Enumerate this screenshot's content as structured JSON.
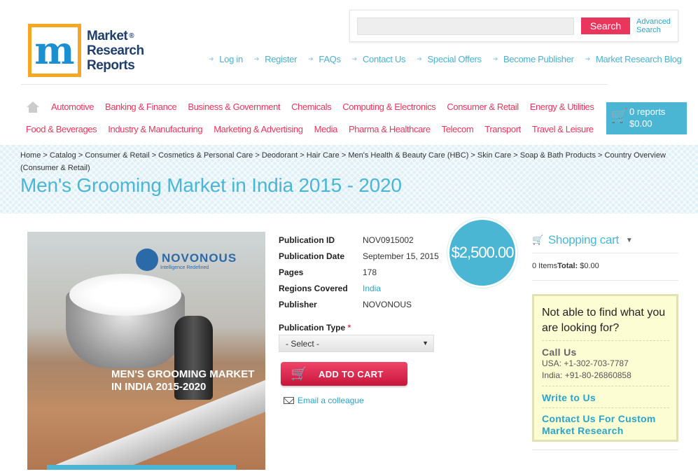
{
  "logo": {
    "line1": "Market",
    "line2": "Research",
    "line3": "Reports",
    "reg": "®"
  },
  "search": {
    "button_label": "Search",
    "advanced_line1": "Advanced",
    "advanced_line2": "Search"
  },
  "toplinks": [
    "Log in",
    "Register",
    "FAQs",
    "Contact Us",
    "Special Offers",
    "Become Publisher",
    "Market Research Blog"
  ],
  "categories_row1": [
    "Automotive",
    "Banking & Finance",
    "Business & Government",
    "Chemicals",
    "Computing & Electronics",
    "Consumer & Retail",
    "Energy & Utilities"
  ],
  "categories_row2": [
    "Food & Beverages",
    "Industry & Manufacturing",
    "Marketing & Advertising",
    "Media",
    "Pharma & Healthcare",
    "Telecom",
    "Transport",
    "Travel & Leisure"
  ],
  "cart": {
    "reports": "0 reports",
    "amount": "$0.00"
  },
  "breadcrumb": "Home > Catalog > Consumer & Retail > Cosmetics & Personal Care > Deodorant > Hair Care > Men's Health & Beauty Care (HBC) > Skin Care > Soap & Bath Products > Country Overview (Consumer & Retail)",
  "title": "Men's Grooming Market in India 2015 - 2020",
  "cover": {
    "brand": "NOVONOUS",
    "brand_sub": "Intelligence Redefined",
    "title_line1": "MEN'S GROOMING MARKET",
    "title_line2": "IN INDIA 2015-2020"
  },
  "details": [
    {
      "label": "Publication ID",
      "value": "NOV0915002"
    },
    {
      "label": "Publication Date",
      "value": "September 15, 2015"
    },
    {
      "label": "Pages",
      "value": "178"
    },
    {
      "label": "Regions Covered",
      "value": "India"
    },
    {
      "label": "Publisher",
      "value": "NOVONOUS"
    }
  ],
  "price": "$2,500.00",
  "publication_type": {
    "label": "Publication Type",
    "required": "*",
    "selected": "- Select -"
  },
  "add_to_cart": "ADD TO CART",
  "email_colleague": "Email a colleague",
  "shopping_cart": {
    "title": "Shopping cart",
    "items": "0 Items",
    "total_label": "Total:",
    "total_value": "$0.00"
  },
  "help": {
    "question": "Not able to find what you are looking for?",
    "call_us": "Call Us",
    "usa": "USA: +1-302-703-7787",
    "india": "India: +91-80-26860858",
    "write_to_us": "Write to Us",
    "custom_research": "Contact Us For Custom Market Research"
  },
  "colors": {
    "accent": "#4ab6d3",
    "pink": "#e8365d",
    "link": "#2aa4c8"
  }
}
